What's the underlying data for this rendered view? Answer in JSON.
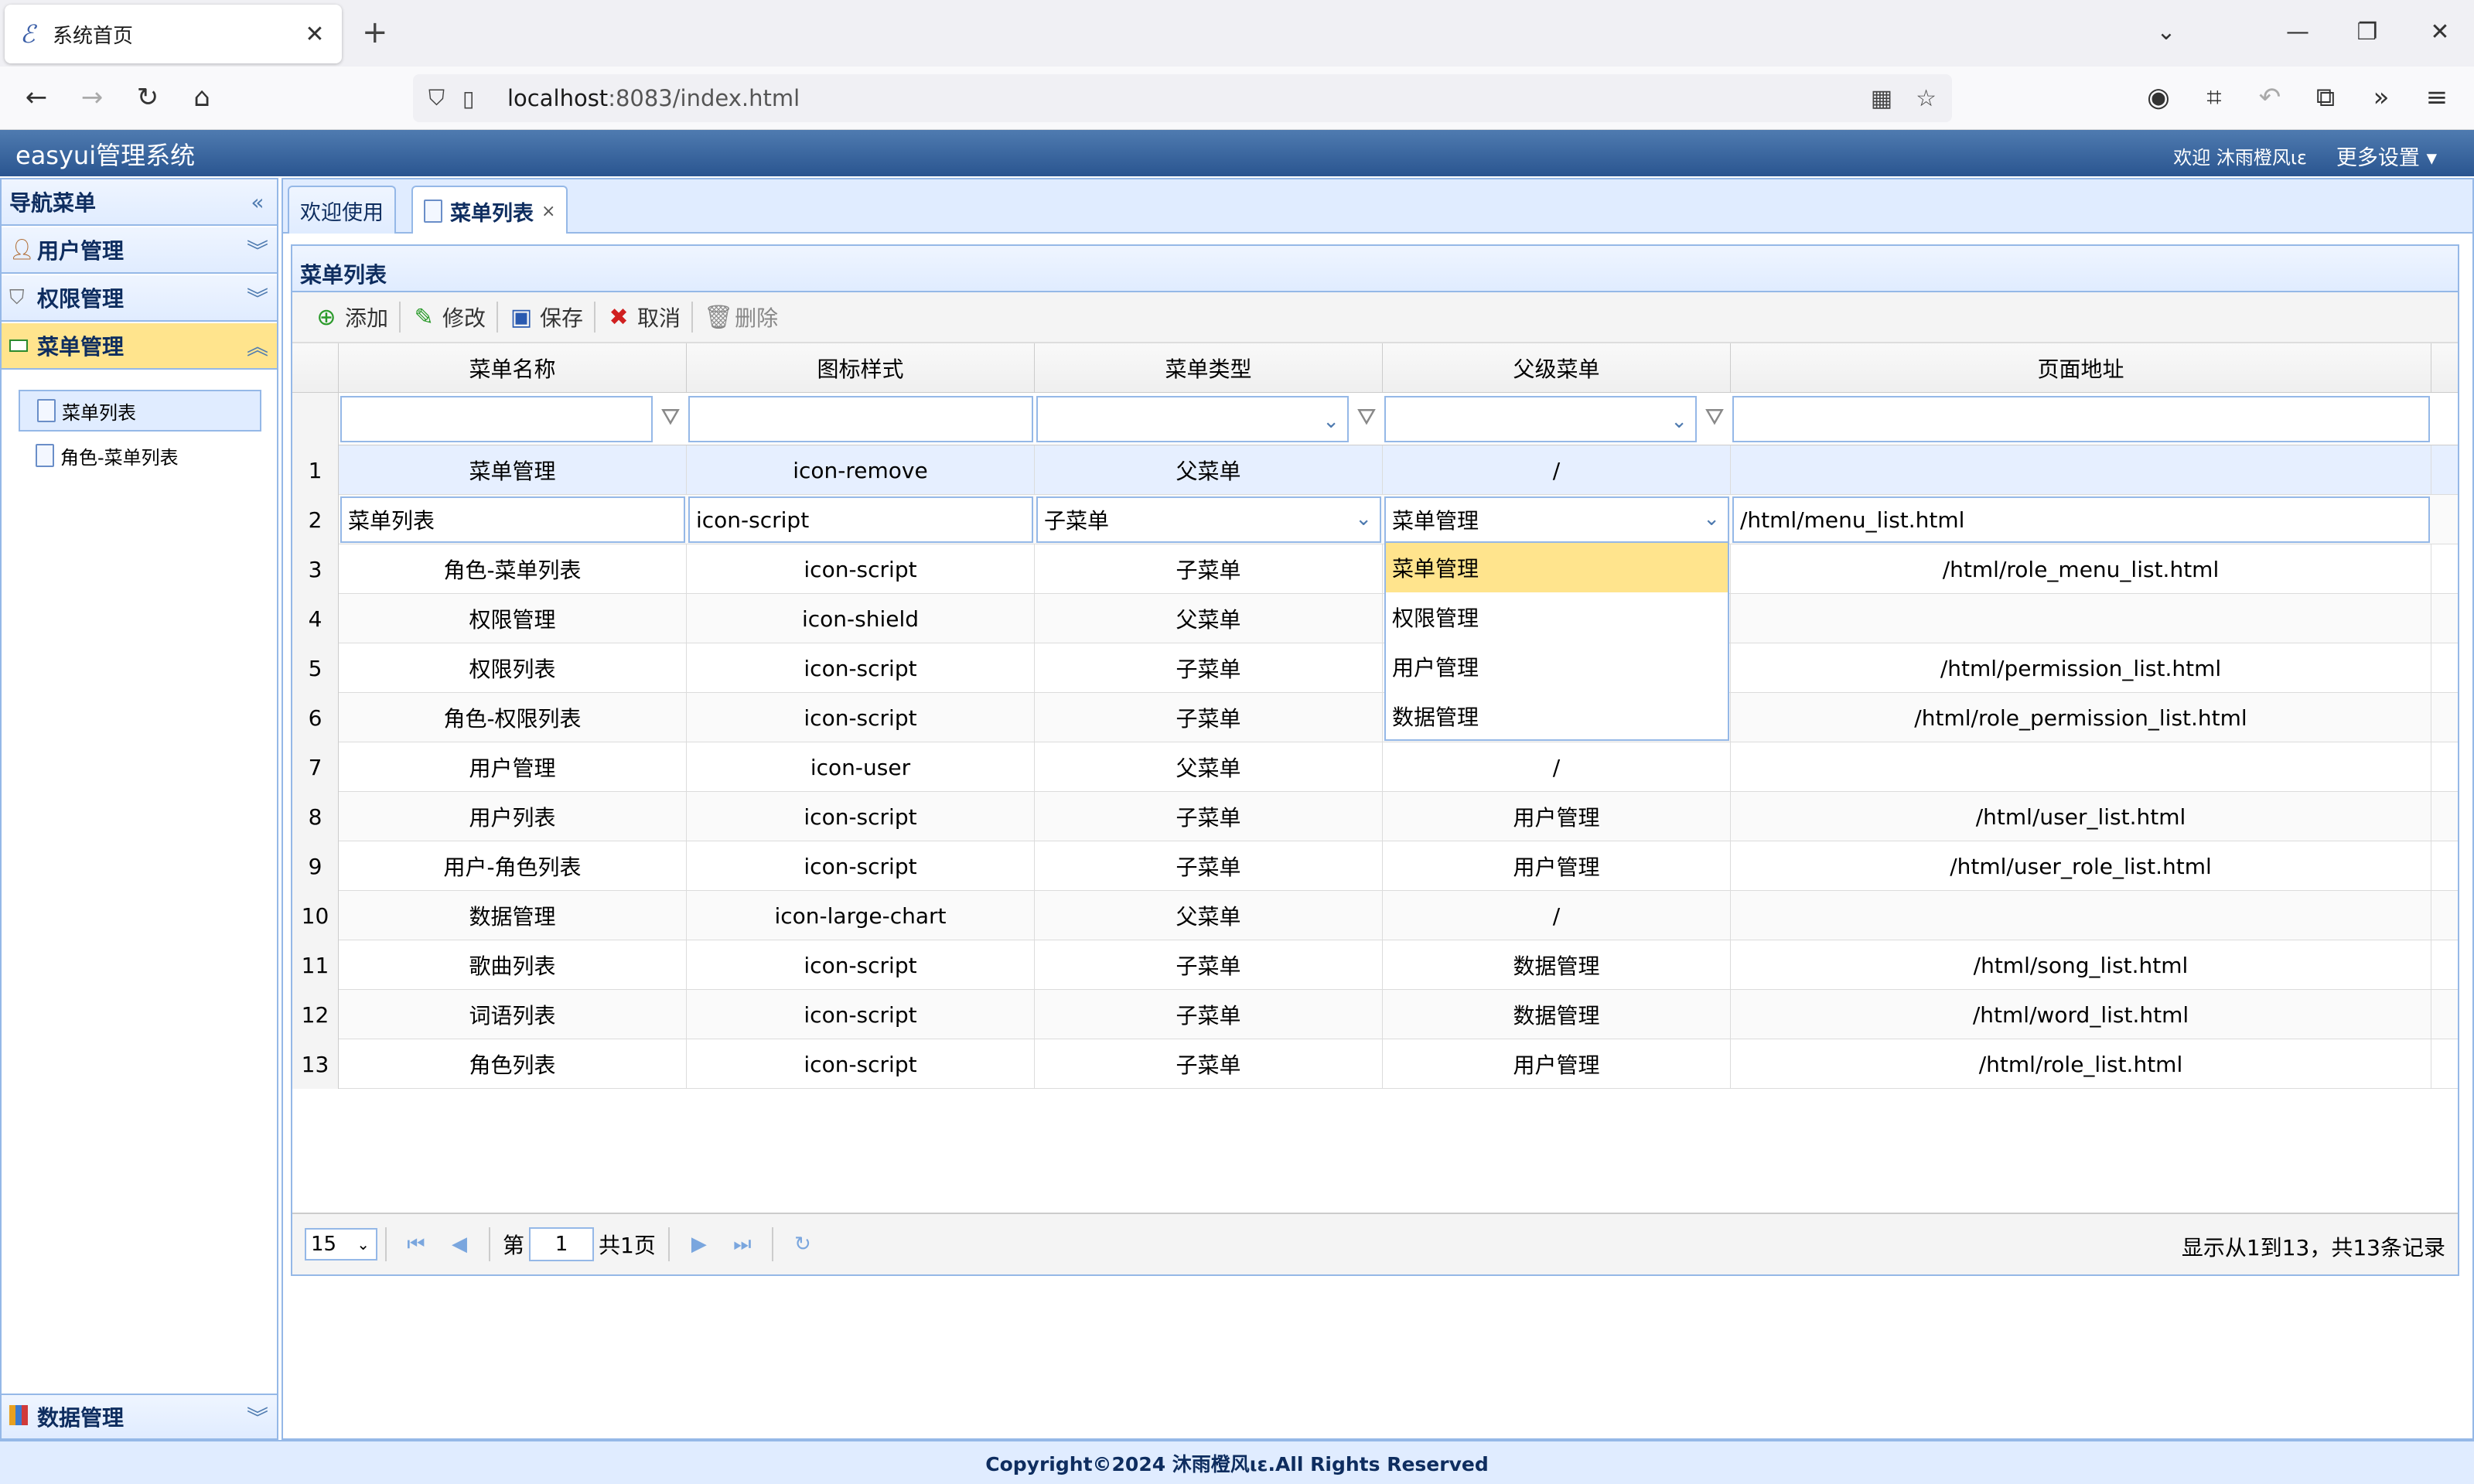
{
  "browser": {
    "tab_title": "系统首页",
    "tab_favicon": "ℰ",
    "url_host": "localhost",
    "url_rest": ":8083/index.html"
  },
  "app": {
    "title": "easyui管理系统",
    "welcome": "欢迎 沐雨橙风ιε",
    "more_settings": "更多设置"
  },
  "nav": {
    "header": "导航菜单",
    "groups": [
      {
        "label": "用户管理",
        "icon": "user-icon"
      },
      {
        "label": "权限管理",
        "icon": "shield-icon"
      },
      {
        "label": "菜单管理",
        "icon": "menu-icon"
      }
    ],
    "items": [
      "菜单列表",
      "角色-菜单列表"
    ],
    "bottom_group": {
      "label": "数据管理",
      "icon": "chart-icon"
    }
  },
  "tabs": [
    {
      "label": "欢迎使用"
    },
    {
      "label": "菜单列表"
    }
  ],
  "grid": {
    "title": "菜单列表",
    "toolbar": [
      {
        "label": "添加",
        "icon": "add-icon"
      },
      {
        "label": "修改",
        "icon": "edit-icon"
      },
      {
        "label": "保存",
        "icon": "save-icon"
      },
      {
        "label": "取消",
        "icon": "cancel-icon"
      },
      {
        "label": "删除",
        "icon": "delete-icon"
      }
    ],
    "columns": [
      "菜单名称",
      "图标样式",
      "菜单类型",
      "父级菜单",
      "页面地址"
    ],
    "rows": [
      {
        "no": "1",
        "name": "菜单管理",
        "icon": "icon-remove",
        "type": "父菜单",
        "parent": "/",
        "url": ""
      },
      {
        "no": "2",
        "name": "菜单列表",
        "icon": "icon-script",
        "type": "子菜单",
        "parent": "菜单管理",
        "url": "/html/menu_list.html"
      },
      {
        "no": "3",
        "name": "角色-菜单列表",
        "icon": "icon-script",
        "type": "子菜单",
        "parent": "",
        "url": "/html/role_menu_list.html"
      },
      {
        "no": "4",
        "name": "权限管理",
        "icon": "icon-shield",
        "type": "父菜单",
        "parent": "",
        "url": ""
      },
      {
        "no": "5",
        "name": "权限列表",
        "icon": "icon-script",
        "type": "子菜单",
        "parent": "",
        "url": "/html/permission_list.html"
      },
      {
        "no": "6",
        "name": "角色-权限列表",
        "icon": "icon-script",
        "type": "子菜单",
        "parent": "",
        "url": "/html/role_permission_list.html"
      },
      {
        "no": "7",
        "name": "用户管理",
        "icon": "icon-user",
        "type": "父菜单",
        "parent": "/",
        "url": ""
      },
      {
        "no": "8",
        "name": "用户列表",
        "icon": "icon-script",
        "type": "子菜单",
        "parent": "用户管理",
        "url": "/html/user_list.html"
      },
      {
        "no": "9",
        "name": "用户-角色列表",
        "icon": "icon-script",
        "type": "子菜单",
        "parent": "用户管理",
        "url": "/html/user_role_list.html"
      },
      {
        "no": "10",
        "name": "数据管理",
        "icon": "icon-large-chart",
        "type": "父菜单",
        "parent": "/",
        "url": ""
      },
      {
        "no": "11",
        "name": "歌曲列表",
        "icon": "icon-script",
        "type": "子菜单",
        "parent": "数据管理",
        "url": "/html/song_list.html"
      },
      {
        "no": "12",
        "name": "词语列表",
        "icon": "icon-script",
        "type": "子菜单",
        "parent": "数据管理",
        "url": "/html/word_list.html"
      },
      {
        "no": "13",
        "name": "角色列表",
        "icon": "icon-script",
        "type": "子菜单",
        "parent": "用户管理",
        "url": "/html/role_list.html"
      }
    ],
    "dropdown_options": [
      "菜单管理",
      "权限管理",
      "用户管理",
      "数据管理"
    ],
    "pager": {
      "page_size": "15",
      "page_prefix": "第",
      "page_number": "1",
      "page_suffix": "共1页",
      "info": "显示从1到13，共13条记录"
    }
  },
  "footer": "Copyright©2024 沐雨橙风ιε.All Rights Reserved",
  "colors": {
    "accent": "#95b8e7",
    "selected": "#ffe48d",
    "header": "#2a5590"
  }
}
